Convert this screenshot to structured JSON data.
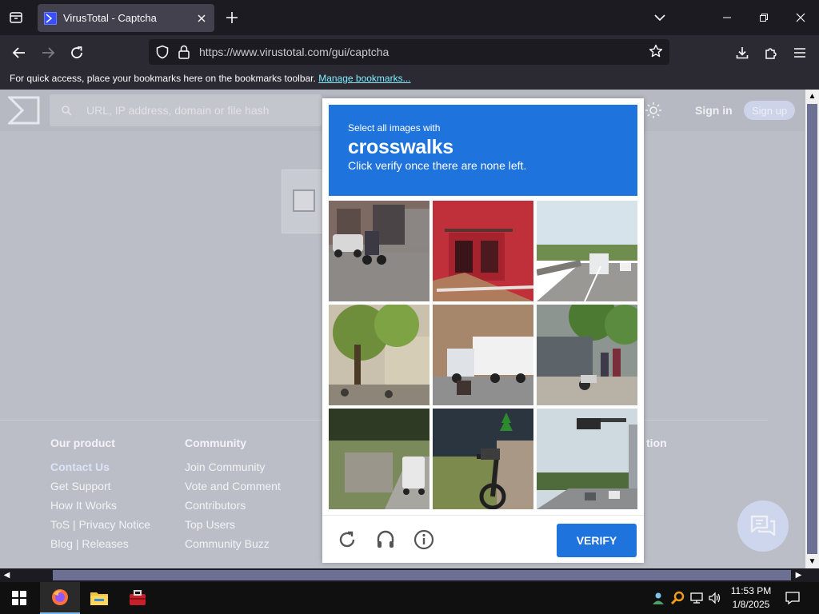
{
  "browser": {
    "tab_title": "VirusTotal - Captcha",
    "url": "https://www.virustotal.com/gui/captcha",
    "bookmarks_message": "For quick access, place your bookmarks here on the bookmarks toolbar.",
    "bookmarks_link": "Manage bookmarks..."
  },
  "vt": {
    "search_placeholder": "URL, IP address, domain or file hash",
    "sign_in": "Sign in",
    "sign_up": "Sign up",
    "footer": [
      {
        "heading": "Our product",
        "links": [
          "Contact Us",
          "Get Support",
          "How It Works",
          "ToS | Privacy Notice",
          "Blog | Releases"
        ]
      },
      {
        "heading": "Community",
        "links": [
          "Join Community",
          "Vote and Comment",
          "Contributors",
          "Top Users",
          "Community Buzz"
        ]
      }
    ],
    "footer_partial_heading": "tion"
  },
  "captcha": {
    "prompt_line1": "Select all images with",
    "prompt_target": "crosswalks",
    "prompt_line3": "Click verify once there are none left.",
    "verify_label": "VERIFY",
    "tiles": [
      "street-motorcycle-cars",
      "red-building-balcony",
      "highway-truck",
      "tree-lined-plaza",
      "truck-motorcyclist",
      "market-stalls-motorcycles",
      "country-road-van",
      "motorcycle-dirt",
      "city-street-traffic-light"
    ]
  },
  "taskbar": {
    "time": "11:53 PM",
    "date": "1/8/2025"
  },
  "colors": {
    "captcha_blue": "#1e74dc",
    "page_dim": "#bcbec7",
    "browser_dark": "#1c1b22",
    "scroll_thumb": "#6c7093"
  }
}
